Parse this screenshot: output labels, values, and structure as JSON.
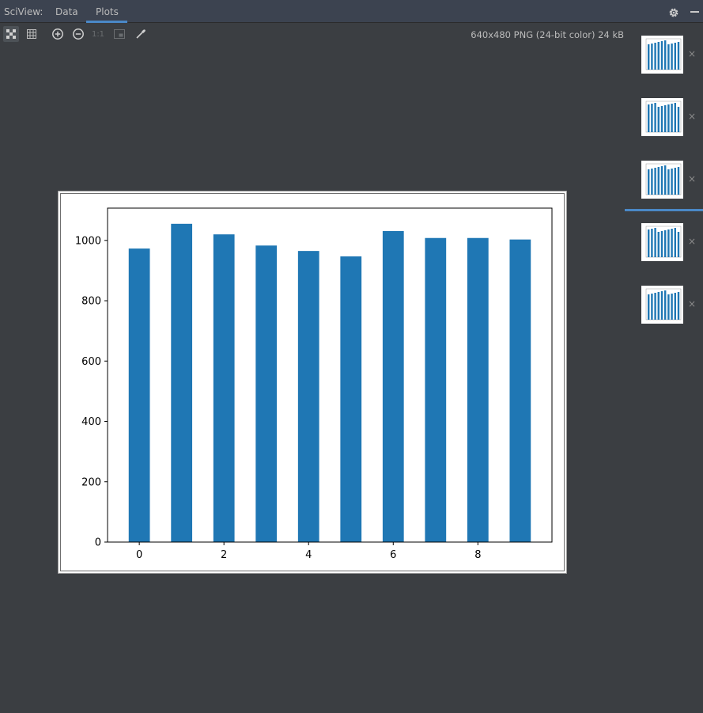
{
  "header": {
    "title": "SciView:",
    "tabs": [
      {
        "label": "Data"
      },
      {
        "label": "Plots"
      }
    ],
    "active_tab": "Plots"
  },
  "toolbar": {
    "buttons": [
      {
        "icon": "fit-to-window-icon",
        "active": true
      },
      {
        "icon": "grid-icon",
        "active": false
      },
      {
        "icon": "zoom-in-icon",
        "active": false
      },
      {
        "icon": "zoom-out-icon",
        "active": false
      },
      {
        "label": "1:1",
        "icon": "actual-size-icon",
        "active": false
      },
      {
        "icon": "background-icon",
        "active": false
      },
      {
        "icon": "color-picker-icon",
        "active": false
      }
    ],
    "actual_size_label": "1:1"
  },
  "image_info": "640x480 PNG (24-bit color) 24 kB",
  "thumbnails": {
    "count": 5,
    "selected_index": 2,
    "close_label": "×"
  },
  "colors": {
    "bar": "#1f77b4",
    "accent": "#4a88c7",
    "background": "#3b3e42"
  },
  "chart_data": {
    "type": "bar",
    "categories": [
      0,
      1,
      2,
      3,
      4,
      5,
      6,
      7,
      8,
      9
    ],
    "values": [
      973,
      1055,
      1020,
      983,
      965,
      947,
      1031,
      1008,
      1008,
      1003
    ],
    "xticks": [
      0,
      2,
      4,
      6,
      8
    ],
    "yticks": [
      0,
      200,
      400,
      600,
      800,
      1000
    ],
    "xlim": [
      -0.75,
      9.75
    ],
    "ylim": [
      0,
      1107
    ],
    "title": "",
    "xlabel": "",
    "ylabel": "",
    "grid": false
  }
}
